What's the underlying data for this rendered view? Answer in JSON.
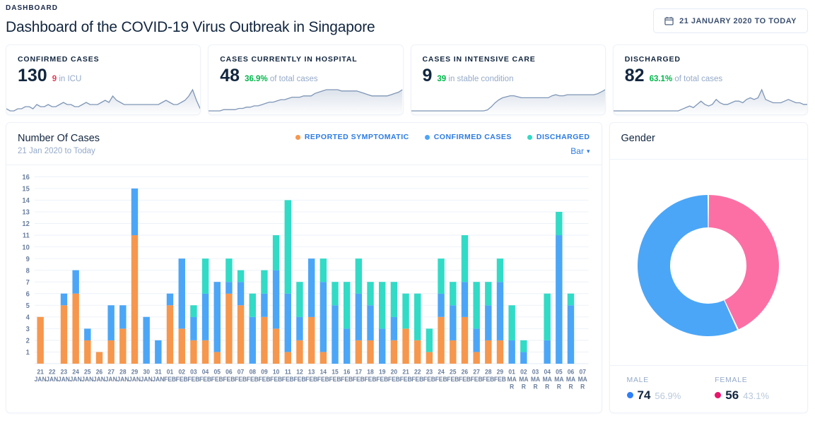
{
  "header": {
    "eyebrow": "DASHBOARD",
    "title": "Dashboard of the COVID-19 Virus Outbreak in Singapore",
    "date_range_button": "21 JANUARY 2020 TO TODAY",
    "calendar_icon": "calendar-icon"
  },
  "kpis": [
    {
      "label": "CONFIRMED CASES",
      "value": "130",
      "accent": "9",
      "accent_color": "#e63757",
      "suffix": "in ICU",
      "spark": [
        8,
        7,
        7,
        8,
        8,
        9,
        9,
        8,
        10,
        9,
        9,
        10,
        9,
        9,
        10,
        11,
        10,
        10,
        9,
        9,
        10,
        11,
        10,
        10,
        10,
        11,
        12,
        11,
        14,
        12,
        11,
        10,
        10,
        10,
        10,
        10,
        10,
        10,
        10,
        10,
        10,
        11,
        12,
        11,
        10,
        10,
        11,
        12,
        14,
        17,
        12,
        8
      ]
    },
    {
      "label": "CASES CURRENTLY IN HOSPITAL",
      "value": "48",
      "accent": "36.9%",
      "accent_color": "#00b74a",
      "suffix": "of total cases",
      "spark": [
        2,
        2,
        2,
        2,
        3,
        3,
        3,
        3,
        4,
        4,
        5,
        5,
        6,
        6,
        7,
        8,
        9,
        9,
        10,
        11,
        11,
        12,
        13,
        13,
        13,
        14,
        14,
        14,
        16,
        17,
        18,
        19,
        19,
        19,
        19,
        18,
        18,
        18,
        18,
        18,
        17,
        16,
        15,
        14,
        14,
        14,
        14,
        14,
        15,
        16,
        17,
        19
      ]
    },
    {
      "label": "CASES IN INTENSIVE CARE",
      "value": "9",
      "accent": "39",
      "accent_color": "#00b74a",
      "suffix": "in stable condition",
      "spark": [
        1,
        1,
        1,
        1,
        1,
        1,
        1,
        1,
        1,
        1,
        1,
        1,
        1,
        1,
        1,
        1,
        1,
        1,
        1,
        1,
        2,
        5,
        9,
        12,
        14,
        15,
        16,
        16,
        15,
        14,
        14,
        14,
        14,
        14,
        14,
        14,
        14,
        16,
        17,
        16,
        16,
        17,
        17,
        17,
        17,
        17,
        17,
        17,
        17,
        18,
        20,
        22
      ]
    },
    {
      "label": "DISCHARGED",
      "value": "82",
      "accent": "63.1%",
      "accent_color": "#00b74a",
      "suffix": "of total cases",
      "spark": [
        1,
        1,
        1,
        1,
        1,
        1,
        1,
        1,
        1,
        1,
        1,
        1,
        1,
        1,
        1,
        1,
        1,
        1,
        2,
        3,
        4,
        3,
        5,
        7,
        5,
        4,
        5,
        8,
        6,
        5,
        5,
        6,
        7,
        7,
        6,
        8,
        9,
        8,
        9,
        14,
        8,
        7,
        6,
        6,
        6,
        7,
        8,
        7,
        6,
        6,
        5,
        5
      ]
    }
  ],
  "chart_panel": {
    "title": "Number Of Cases",
    "subtitle": "21 Jan 2020 to Today",
    "type_selector": "Bar",
    "caret_icon": "chevron-down-icon",
    "legend": [
      {
        "label": "REPORTED SYMPTOMATIC",
        "color": "#f6974d"
      },
      {
        "label": "CONFIRMED CASES",
        "color": "#4ba6f7"
      },
      {
        "label": "DISCHARGED",
        "color": "#32dbc6"
      }
    ]
  },
  "chart_data": {
    "type": "bar",
    "stacked": true,
    "title": "Number Of Cases",
    "subtitle": "21 Jan 2020 to Today",
    "xlabel": "",
    "ylabel": "",
    "ylim": [
      0,
      16
    ],
    "yticks": [
      1,
      2,
      3,
      4,
      5,
      6,
      7,
      8,
      9,
      10,
      11,
      12,
      13,
      14,
      15,
      16
    ],
    "grid": true,
    "categories": [
      "21 JAN",
      "22 JAN",
      "23 JAN",
      "24 JAN",
      "25 JAN",
      "26 JAN",
      "27 JAN",
      "28 JAN",
      "29 JAN",
      "30 JAN",
      "31 JAN",
      "01 FEB",
      "02 FEB",
      "03 FEB",
      "04 FEB",
      "05 FEB",
      "06 FEB",
      "07 FEB",
      "08 FEB",
      "09 FEB",
      "10 FEB",
      "11 FEB",
      "12 FEB",
      "13 FEB",
      "14 FEB",
      "15 FEB",
      "16 FEB",
      "17 FEB",
      "18 FEB",
      "19 FEB",
      "20 FEB",
      "21 FEB",
      "22 FEB",
      "23 FEB",
      "24 FEB",
      "25 FEB",
      "26 FEB",
      "27 FEB",
      "28 FEB",
      "29 FEB",
      "01 MAR",
      "02 MAR",
      "03 MAR",
      "04 MAR",
      "05 MAR",
      "06 MAR",
      "07 MAR"
    ],
    "series": [
      {
        "name": "REPORTED SYMPTOMATIC",
        "color": "#f6974d",
        "values": [
          4,
          0,
          5,
          6,
          2,
          1,
          2,
          3,
          11,
          0,
          0,
          5,
          3,
          2,
          2,
          1,
          6,
          5,
          0,
          4,
          3,
          1,
          2,
          4,
          1,
          0,
          0,
          2,
          2,
          0,
          2,
          3,
          2,
          1,
          4,
          2,
          4,
          1,
          2,
          2,
          0,
          0,
          0,
          0,
          0,
          0,
          0
        ]
      },
      {
        "name": "CONFIRMED CASES",
        "color": "#4ba6f7",
        "values": [
          0,
          0,
          1,
          2,
          1,
          0,
          3,
          2,
          4,
          4,
          2,
          1,
          6,
          2,
          4,
          6,
          1,
          2,
          4,
          2,
          5,
          5,
          2,
          5,
          6,
          5,
          3,
          4,
          3,
          3,
          2,
          0,
          0,
          0,
          2,
          3,
          3,
          2,
          3,
          5,
          2,
          1,
          0,
          2,
          11,
          5,
          0
        ]
      },
      {
        "name": "DISCHARGED",
        "color": "#32dbc6",
        "values": [
          0,
          0,
          0,
          0,
          0,
          0,
          0,
          0,
          0,
          0,
          0,
          0,
          0,
          1,
          3,
          0,
          2,
          1,
          2,
          2,
          3,
          8,
          3,
          0,
          2,
          2,
          4,
          3,
          2,
          4,
          3,
          3,
          4,
          2,
          3,
          2,
          4,
          4,
          2,
          2,
          3,
          1,
          0,
          4,
          2,
          1,
          0
        ]
      }
    ],
    "totals": [
      4,
      0,
      6,
      8,
      3,
      1,
      5,
      5,
      15,
      4,
      2,
      6,
      9,
      5,
      9,
      7,
      9,
      8,
      6,
      8,
      11,
      14,
      7,
      9,
      9,
      7,
      7,
      9,
      7,
      7,
      7,
      6,
      6,
      3,
      9,
      7,
      11,
      7,
      7,
      9,
      5,
      2,
      0,
      6,
      13,
      6,
      0
    ]
  },
  "gender_panel": {
    "title": "Gender",
    "segments": [
      {
        "name": "MALE",
        "count": "74",
        "percent": "56.9%",
        "color": "#4ba6f7",
        "fraction": 0.569
      },
      {
        "name": "FEMALE",
        "count": "56",
        "percent": "43.1%",
        "color": "#fc6fa5",
        "fraction": 0.431
      }
    ],
    "legend": [
      {
        "name": "MALE",
        "count": "74",
        "percent": "56.9%",
        "dot_color": "#2d7ff9"
      },
      {
        "name": "FEMALE",
        "count": "56",
        "percent": "43.1%",
        "dot_color": "#e8156b"
      }
    ]
  },
  "theme": {
    "accent_blue": "#2c7be5",
    "text_dark": "#12263f",
    "text_muted": "#95aac9",
    "border": "#edf2f9"
  }
}
